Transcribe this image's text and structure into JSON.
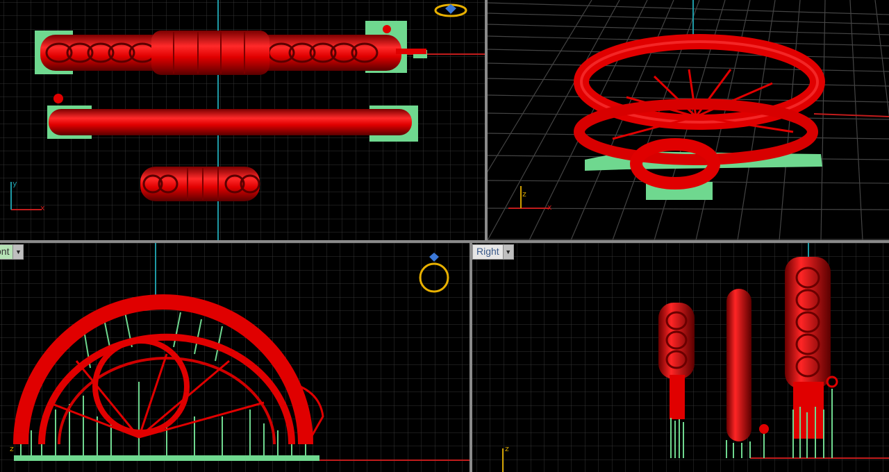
{
  "viewports": {
    "top": {
      "axis_x": "x",
      "axis_y": "y"
    },
    "perspective": {
      "axis_x": "x",
      "axis_z": "z"
    },
    "front": {
      "label": "ont",
      "axis_z": "z"
    },
    "right": {
      "label": "Right",
      "axis_z": "z"
    }
  },
  "icons": {
    "top_gumball": "ring-gem-icon",
    "front_gumball": "ring-gem-icon",
    "dropdown": "chevron-down-icon"
  },
  "colors": {
    "model": "#e00000",
    "supports": "#6fd88f",
    "grid": "#3c3c3c",
    "axis_x": "#c81e1e",
    "axis_y": "#1ec8c8",
    "gumball": "#e8b000"
  }
}
